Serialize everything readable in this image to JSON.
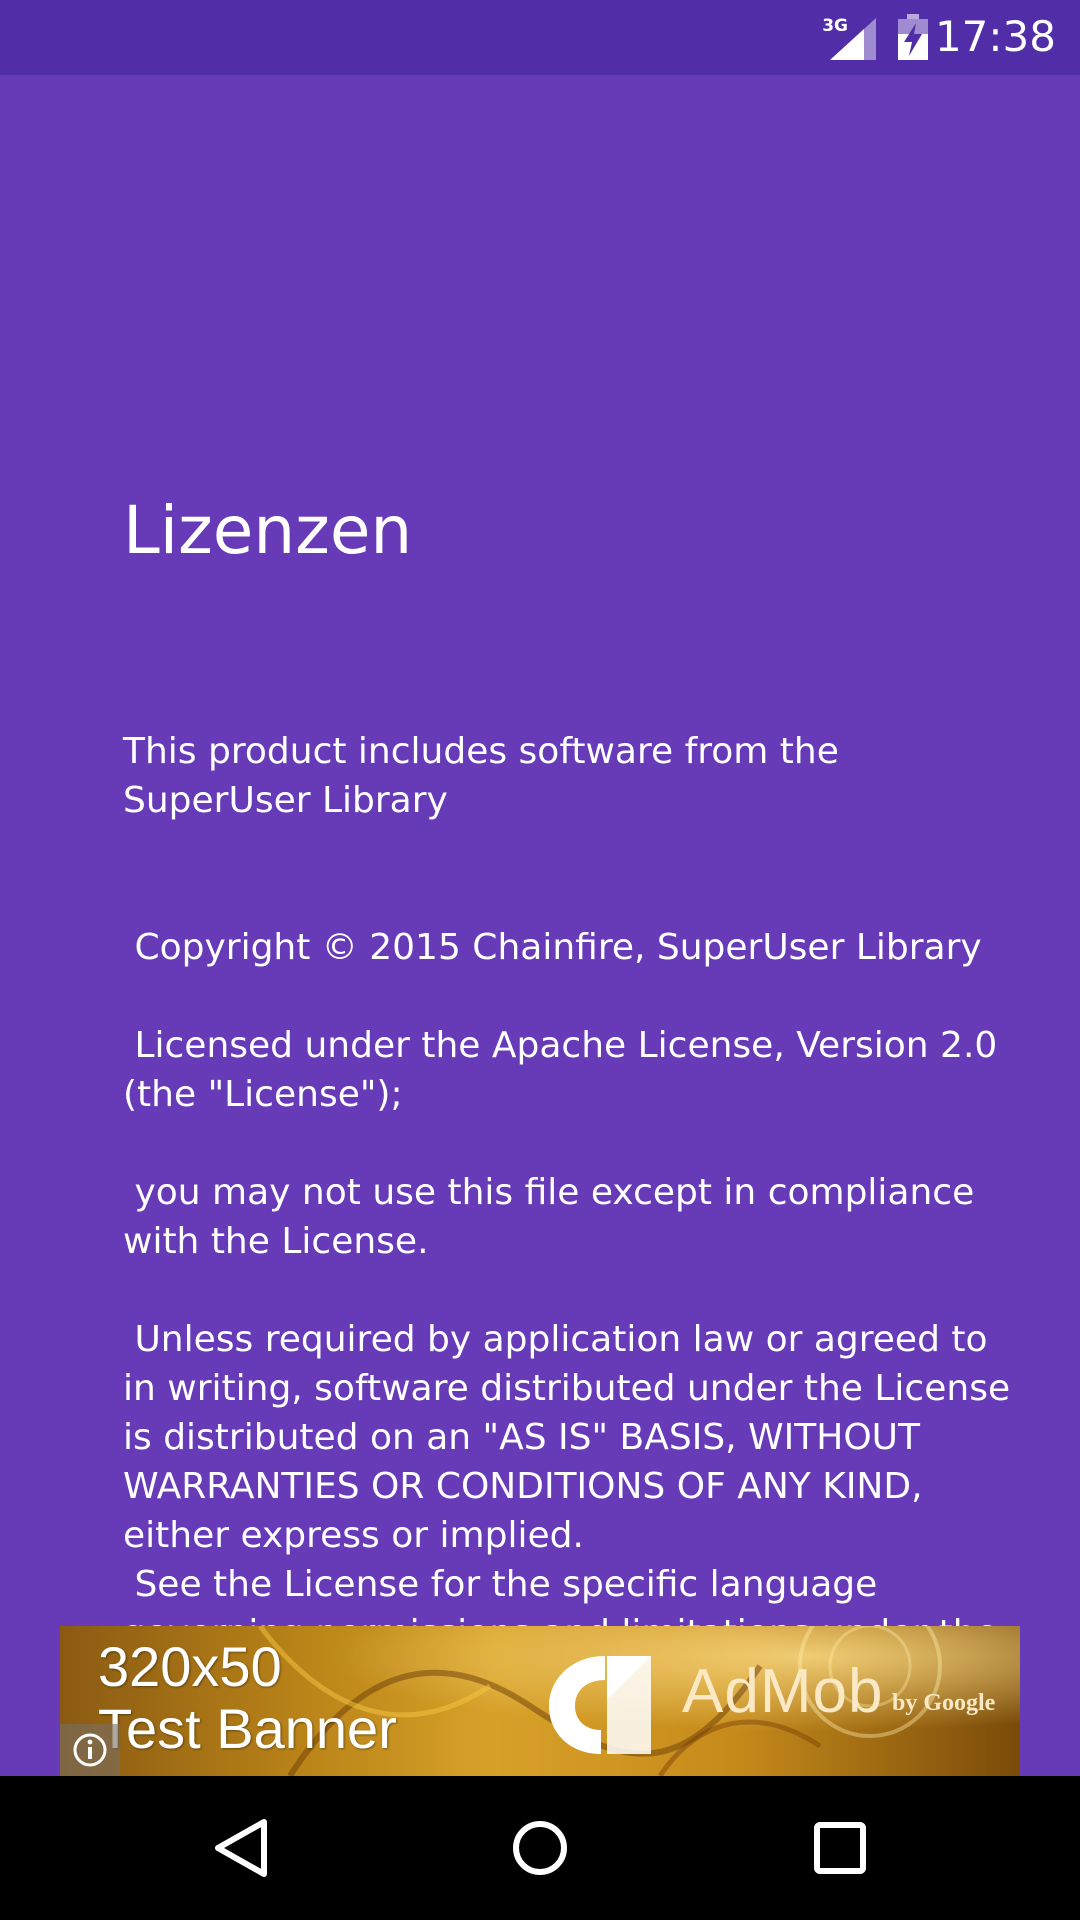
{
  "status_bar": {
    "network_type": "3G",
    "time": "17:38",
    "icons": [
      "signal-icon",
      "battery-charging-icon"
    ]
  },
  "page": {
    "title": "Lizenzen",
    "body": "This product includes software from the\nSuperUser Library\n\n\n Copyright © 2015 Chainfire, SuperUser Library\n\n Licensed under the Apache License, Version 2.0\n(the \"License\");\n\n you may not use this file except in compliance\nwith the License.\n\n Unless required by application law or agreed to\nin writing, software distributed under the License\nis distributed on an \"AS IS\" BASIS, WITHOUT\nWARRANTIES OR CONDITIONS OF ANY KIND,\neither express or implied.\n See the License for the specific language\ngoverning permissions and limitations under the\nLicense."
  },
  "ad_banner": {
    "size_label": "320x50",
    "label": "Test Banner",
    "brand": "AdMob",
    "by": "by Google",
    "icons": [
      "admob-logo-icon",
      "info-icon"
    ]
  },
  "navigation": {
    "icons": [
      "back-icon",
      "home-icon",
      "recents-icon"
    ]
  },
  "colors": {
    "background": "#673ab7",
    "status_bar": "#512da8",
    "nav_bar": "#000000",
    "text": "#ffffff"
  }
}
